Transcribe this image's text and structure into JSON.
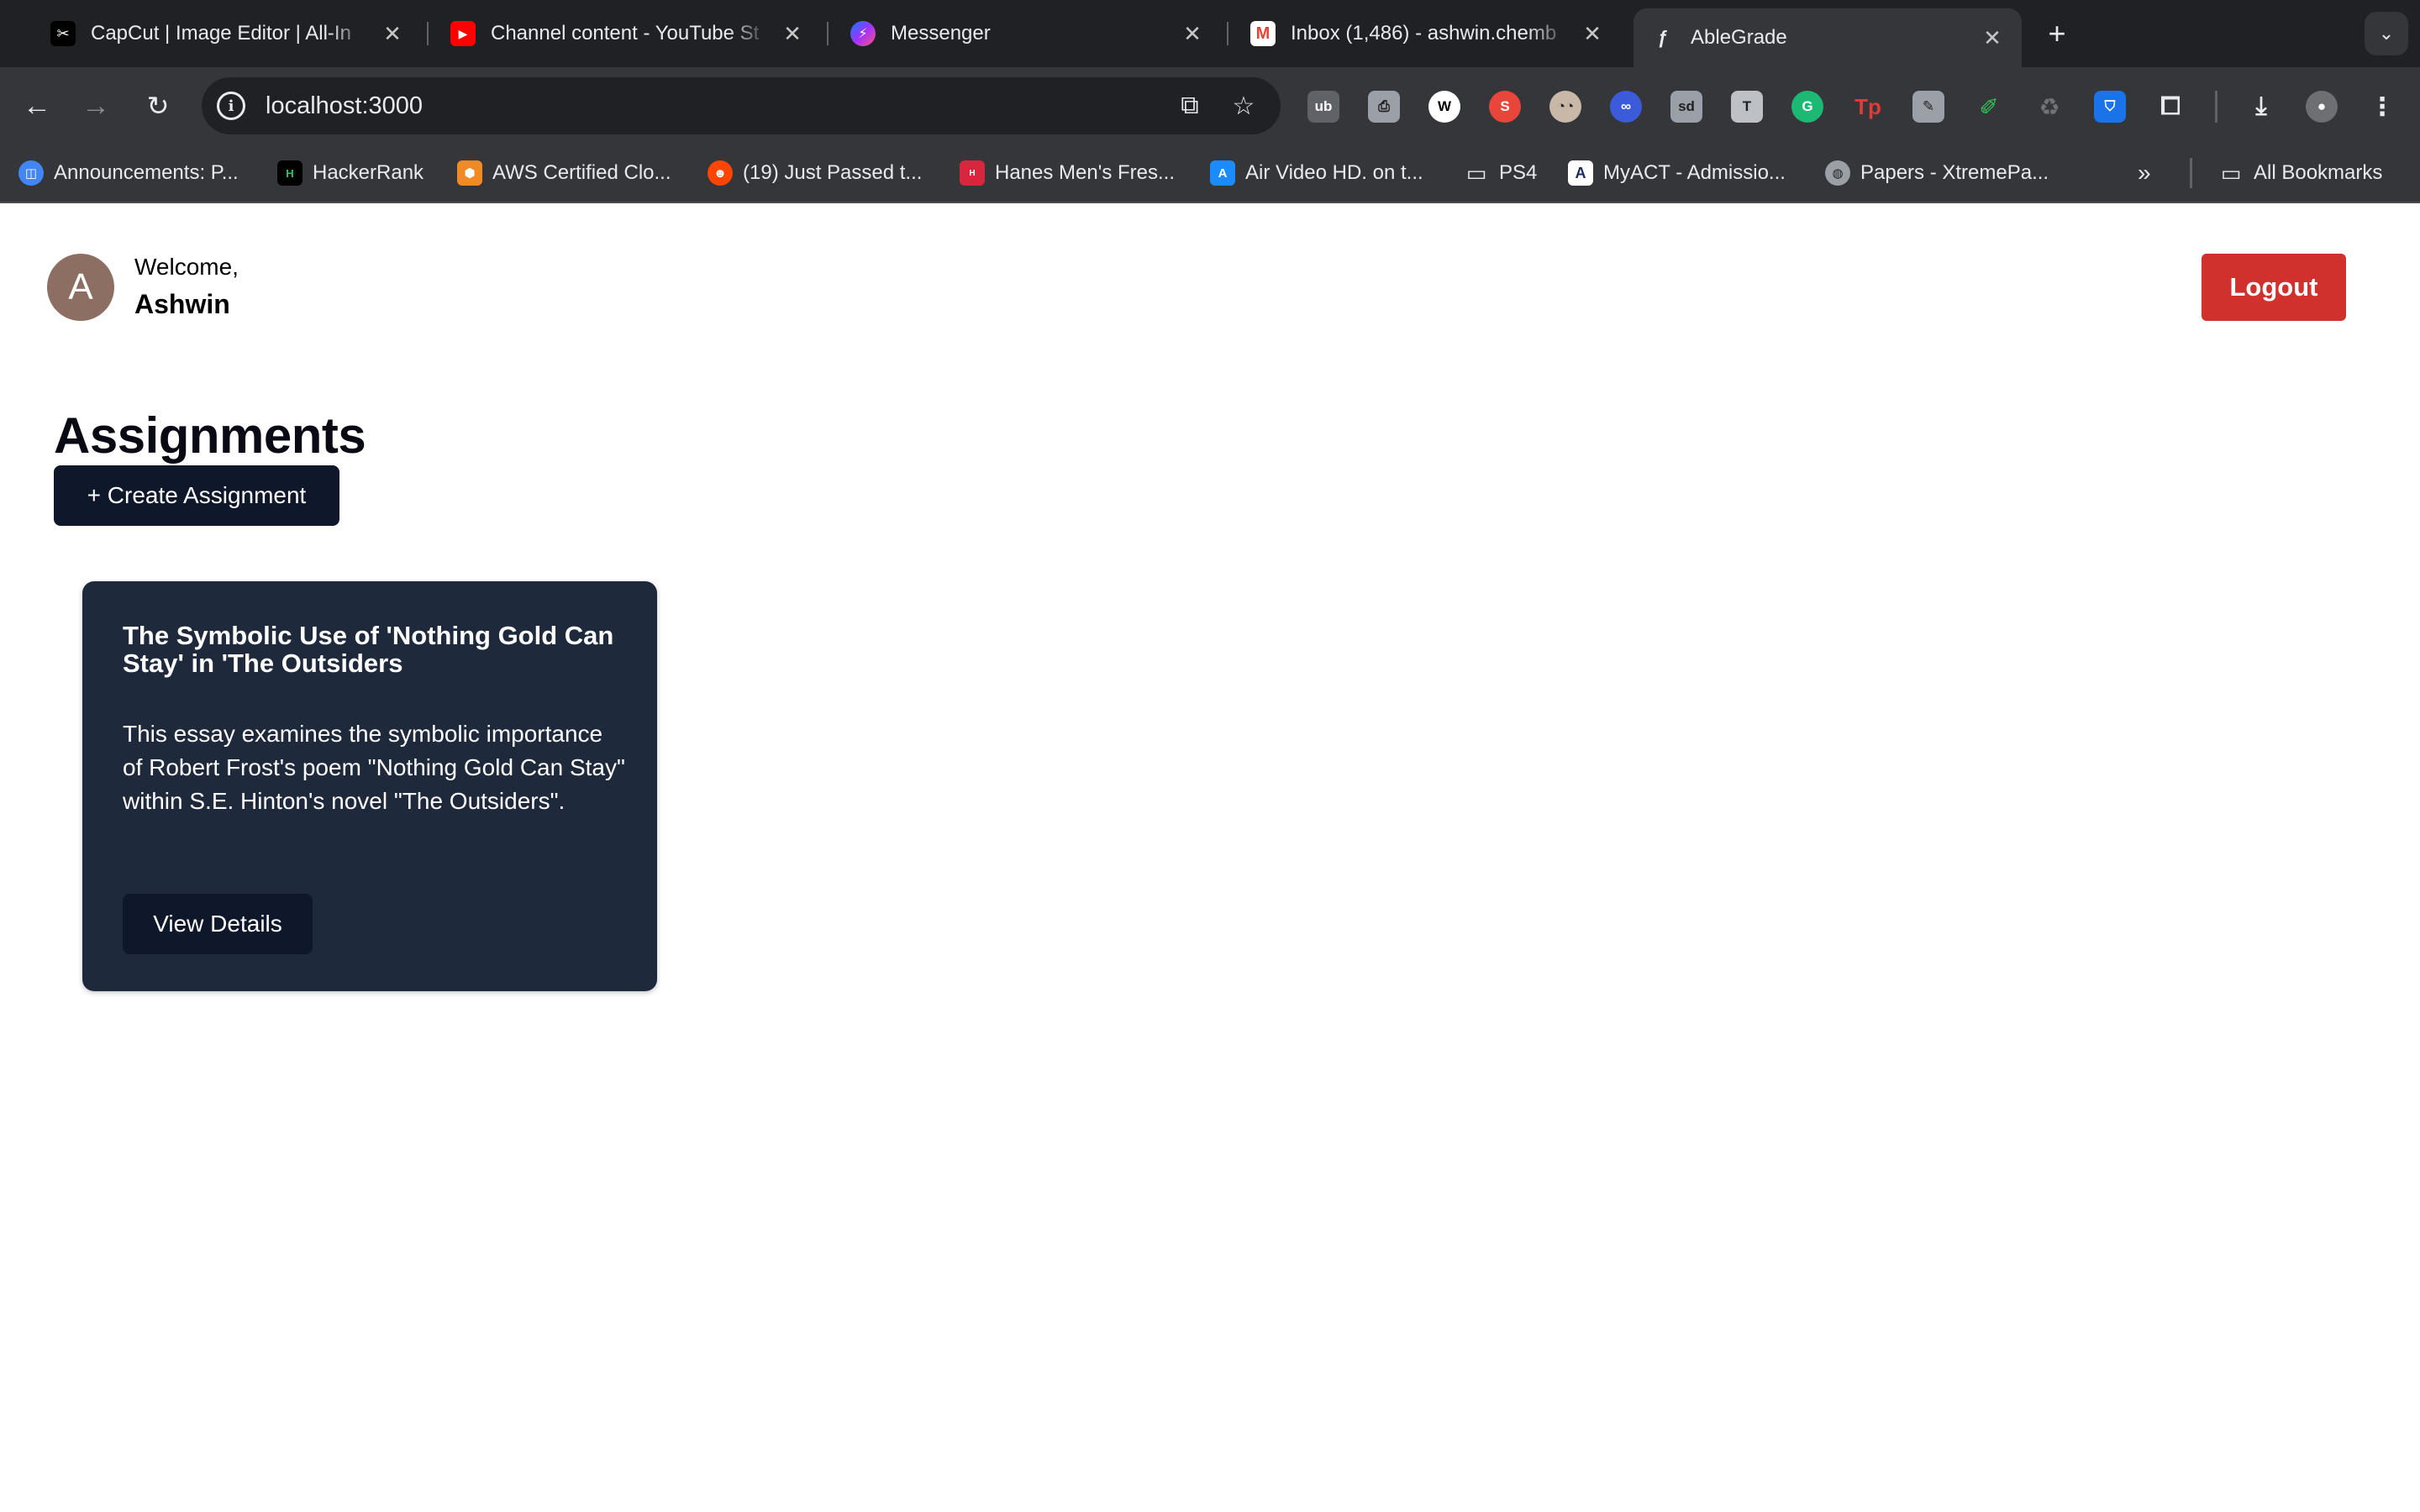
{
  "browser": {
    "tabs": [
      {
        "title": "CapCut | Image Editor | All-In",
        "icon": "capcut-icon",
        "active": false
      },
      {
        "title": "Channel content - YouTube St",
        "icon": "youtube-icon",
        "active": false
      },
      {
        "title": "Messenger",
        "icon": "messenger-icon",
        "active": false
      },
      {
        "title": "Inbox (1,486) - ashwin.chemb",
        "icon": "gmail-icon",
        "active": false
      },
      {
        "title": "AbleGrade",
        "icon": "ablegrade-icon",
        "active": true
      }
    ],
    "close_glyph": "✕",
    "new_tab_glyph": "+",
    "tab_search_glyph": "⌄",
    "url": "localhost:3000",
    "bookmarks": [
      {
        "label": "Announcements: P...",
        "icon": "announcements-icon"
      },
      {
        "label": "HackerRank",
        "icon": "hackerrank-icon"
      },
      {
        "label": "AWS Certified Clo...",
        "icon": "aws-icon"
      },
      {
        "label": "(19) Just Passed t...",
        "icon": "reddit-icon"
      },
      {
        "label": "Hanes Men's Fres...",
        "icon": "hanes-icon"
      },
      {
        "label": "Air Video HD. on t...",
        "icon": "app-store-icon"
      },
      {
        "label": "PS4",
        "icon": "folder-icon"
      },
      {
        "label": "MyACT - Admissio...",
        "icon": "act-icon"
      },
      {
        "label": "Papers - XtremePa...",
        "icon": "globe-icon"
      }
    ],
    "all_bookmarks": "All Bookmarks"
  },
  "page": {
    "avatar_letter": "A",
    "welcome": "Welcome,",
    "user_name": "Ashwin",
    "logout": "Logout",
    "heading": "Assignments",
    "create_button": "+ Create Assignment",
    "assignments": [
      {
        "title": "The Symbolic Use of 'Nothing Gold Can Stay' in 'The Outsiders",
        "description": "This essay examines the symbolic importance of Robert Frost's poem \"Nothing Gold Can Stay\" within S.E. Hinton's novel \"The Outsiders\".",
        "button": "View Details"
      }
    ]
  },
  "colors": {
    "logout": "#d0312d",
    "primary_button": "#0f172a",
    "card": "#1e293b",
    "avatar": "#8d6e63"
  }
}
